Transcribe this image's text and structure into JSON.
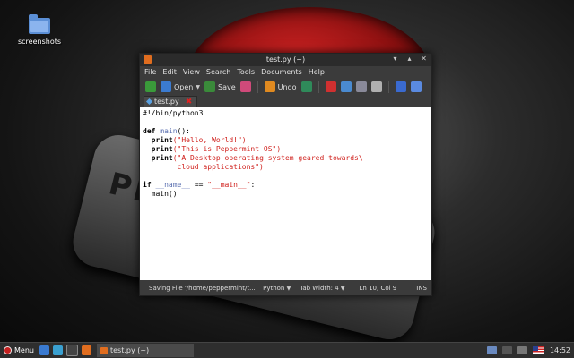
{
  "desktop": {
    "icons": [
      {
        "label": "screenshots",
        "icon": "folder-icon"
      }
    ]
  },
  "window": {
    "title": "test.py (~)",
    "menu": [
      "File",
      "Edit",
      "View",
      "Search",
      "Tools",
      "Documents",
      "Help"
    ],
    "toolbar": {
      "open_label": "Open",
      "save_label": "Save",
      "undo_label": "Undo"
    },
    "tab": {
      "label": "test.py"
    },
    "code": {
      "l1": "#!/bin/python3",
      "def_kw": "def",
      "fn_name": "main",
      "fn_tail": "():",
      "print": "print",
      "s1": "(\"Hello, World!\")",
      "s2": "(\"This is Peppermint OS\")",
      "s3a": "(\"A Desktop operating system geared towards\\",
      "s3b": "        cloud applications\")",
      "if_kw": "if",
      "name_var": "__name__",
      "eq": " == ",
      "main_str": "\"__main__\"",
      "colon": ":",
      "call": "main()"
    },
    "status": {
      "message": "Saving File '/home/peppermint/t...",
      "language": "Python",
      "tab_width": "Tab Width: 4",
      "position": "Ln 10, Col 9",
      "mode": "INS"
    }
  },
  "panel": {
    "menu_label": "Menu",
    "task_label": "test.py (~)",
    "clock": "14:52"
  },
  "colors": {
    "accent": "#e06d1f",
    "string": "#d0211d",
    "builtin": "#5a6fb0"
  }
}
